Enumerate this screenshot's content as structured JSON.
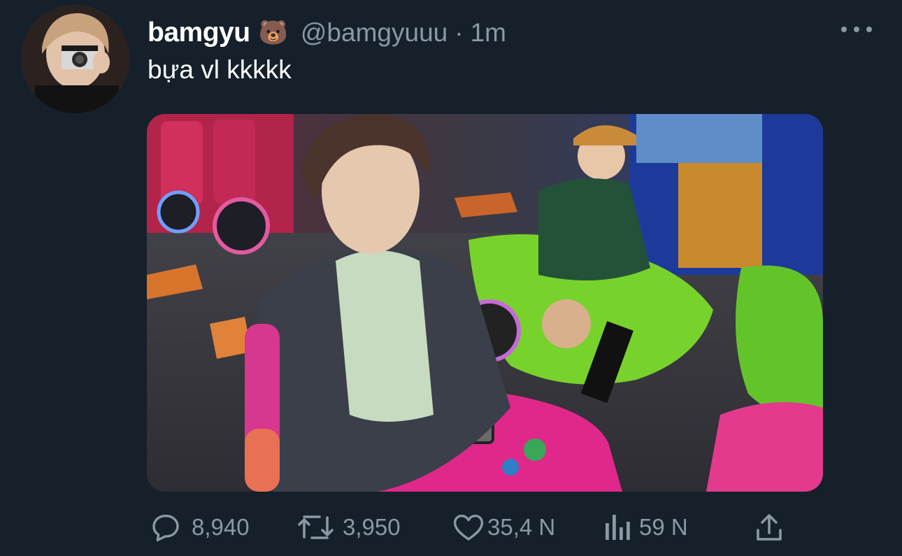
{
  "tweet": {
    "display_name": "bamgyu",
    "name_emoji": "🐻",
    "handle": "@bamgyuuu",
    "separator": "·",
    "time": "1m",
    "text": "bựa vl kkkkk"
  },
  "actions": {
    "replies": "8,940",
    "retweets": "3,950",
    "likes": "35,4 N",
    "views": "59 N"
  },
  "icons": {
    "reply": "reply-bubble-icon",
    "retweet": "retweet-icon",
    "like": "heart-icon",
    "views": "views-bar-chart-icon",
    "share": "share-upload-icon",
    "more": "more-dots-icon"
  },
  "colors": {
    "background": "#15202b",
    "text": "#ffffff",
    "secondary": "#8b98a5"
  }
}
